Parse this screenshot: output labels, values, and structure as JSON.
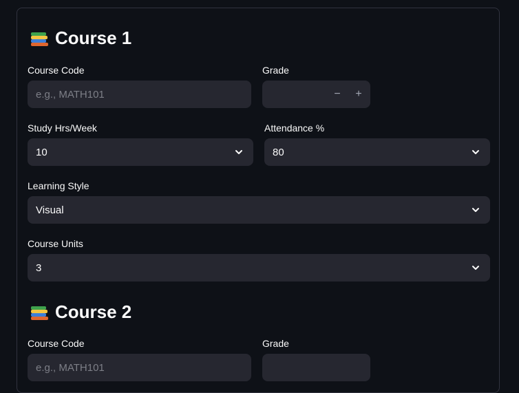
{
  "courses": [
    {
      "title": "Course 1",
      "course_code_label": "Course Code",
      "course_code_placeholder": "e.g., MATH101",
      "course_code_value": "",
      "grade_label": "Grade",
      "grade_value": "",
      "study_label": "Study Hrs/Week",
      "study_value": "10",
      "attendance_label": "Attendance %",
      "attendance_value": "80",
      "learning_label": "Learning Style",
      "learning_value": "Visual",
      "units_label": "Course Units",
      "units_value": "3"
    },
    {
      "title": "Course 2",
      "course_code_label": "Course Code",
      "course_code_placeholder": "e.g., MATH101",
      "grade_label": "Grade"
    }
  ],
  "stepper": {
    "minus": "−",
    "plus": "+"
  },
  "icons": {
    "heading": "books-icon",
    "dropdown": "chevron-down-icon"
  },
  "colors": {
    "background": "#0e1117",
    "field": "#262730",
    "border": "#31333f"
  }
}
